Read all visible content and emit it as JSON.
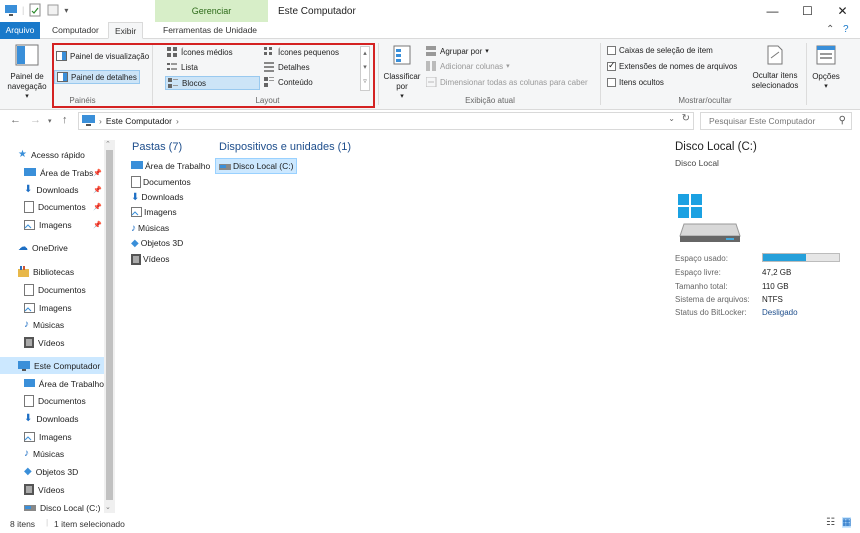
{
  "window": {
    "title": "Este Computador",
    "contextual_tab_group": "Gerenciar",
    "controls": [
      "—",
      "☐",
      "✕"
    ]
  },
  "tabs": {
    "arquivo": "Arquivo",
    "computador": "Computador",
    "exibir": "Exibir",
    "ferramentas": "Ferramentas de Unidade"
  },
  "ribbon": {
    "paineis": {
      "label": "Painéis",
      "nav_pane": "Painel de navegação",
      "preview": "Painel de visualização",
      "details": "Painel de detalhes"
    },
    "layout": {
      "label": "Layout",
      "icones_medios": "Ícones médios",
      "icones_pequenos": "Ícones pequenos",
      "lista": "Lista",
      "detalhes": "Detalhes",
      "blocos": "Blocos",
      "conteudo": "Conteúdo"
    },
    "exibicao_atual": {
      "label": "Exibição atual",
      "classificar": "Classificar por",
      "agrupar": "Agrupar por",
      "adicionar": "Adicionar colunas",
      "dimensionar": "Dimensionar todas as colunas para caber"
    },
    "mostrar": {
      "label": "Mostrar/ocultar",
      "caixas": "Caixas de seleção de item",
      "extensoes": "Extensões de nomes de arquivos",
      "ocultos": "Itens ocultos",
      "ocultar_itens": "Ocultar itens selecionados",
      "opcoes": "Opções"
    }
  },
  "address": {
    "path": "Este Computador",
    "search_placeholder": "Pesquisar Este Computador"
  },
  "nav": {
    "items": [
      {
        "label": "Acesso rápido",
        "icon": "star-icon"
      },
      {
        "label": "Área de Trabs",
        "icon": "desktop-icon"
      },
      {
        "label": "Downloads",
        "icon": "download-icon"
      },
      {
        "label": "Documentos",
        "icon": "document-icon"
      },
      {
        "label": "Imagens",
        "icon": "image-icon"
      },
      {
        "label": "OneDrive",
        "icon": "cloud-icon"
      },
      {
        "label": "Bibliotecas",
        "icon": "library-icon"
      },
      {
        "label": "Documentos",
        "icon": "document-icon"
      },
      {
        "label": "Imagens",
        "icon": "image-icon"
      },
      {
        "label": "Músicas",
        "icon": "music-icon"
      },
      {
        "label": "Vídeos",
        "icon": "video-icon"
      },
      {
        "label": "Este Computador",
        "icon": "computer-icon"
      },
      {
        "label": "Área de Trabalho",
        "icon": "desktop-icon"
      },
      {
        "label": "Documentos",
        "icon": "document-icon"
      },
      {
        "label": "Downloads",
        "icon": "download-icon"
      },
      {
        "label": "Imagens",
        "icon": "image-icon"
      },
      {
        "label": "Músicas",
        "icon": "music-icon"
      },
      {
        "label": "Objetos 3D",
        "icon": "cube-icon"
      },
      {
        "label": "Vídeos",
        "icon": "video-icon"
      },
      {
        "label": "Disco Local (C:)",
        "icon": "drive-icon"
      }
    ]
  },
  "content": {
    "pastas_header": "Pastas (7)",
    "dispositivos_header": "Dispositivos e unidades (1)",
    "folders": [
      "Área de Trabalho",
      "Documentos",
      "Downloads",
      "Imagens",
      "Músicas",
      "Objetos 3D",
      "Vídeos"
    ],
    "drive": "Disco Local (C:)"
  },
  "details": {
    "title": "Disco Local (C:)",
    "subtitle": "Disco Local",
    "usage_fraction": 0.57,
    "rows": [
      {
        "label": "Espaço usado:",
        "value": ""
      },
      {
        "label": "Espaço livre:",
        "value": "47,2 GB"
      },
      {
        "label": "Tamanho total:",
        "value": "110 GB"
      },
      {
        "label": "Sistema de arquivos:",
        "value": "NTFS"
      },
      {
        "label": "Status do BitLocker:",
        "value": "Desligado"
      }
    ]
  },
  "status": {
    "count": "8 itens",
    "selected": "1 item selecionado"
  },
  "colors": {
    "accent": "#1979ca",
    "selection": "#cce8ff",
    "highlight_box": "#d42222",
    "contextual_tab": "#d7eec8"
  }
}
